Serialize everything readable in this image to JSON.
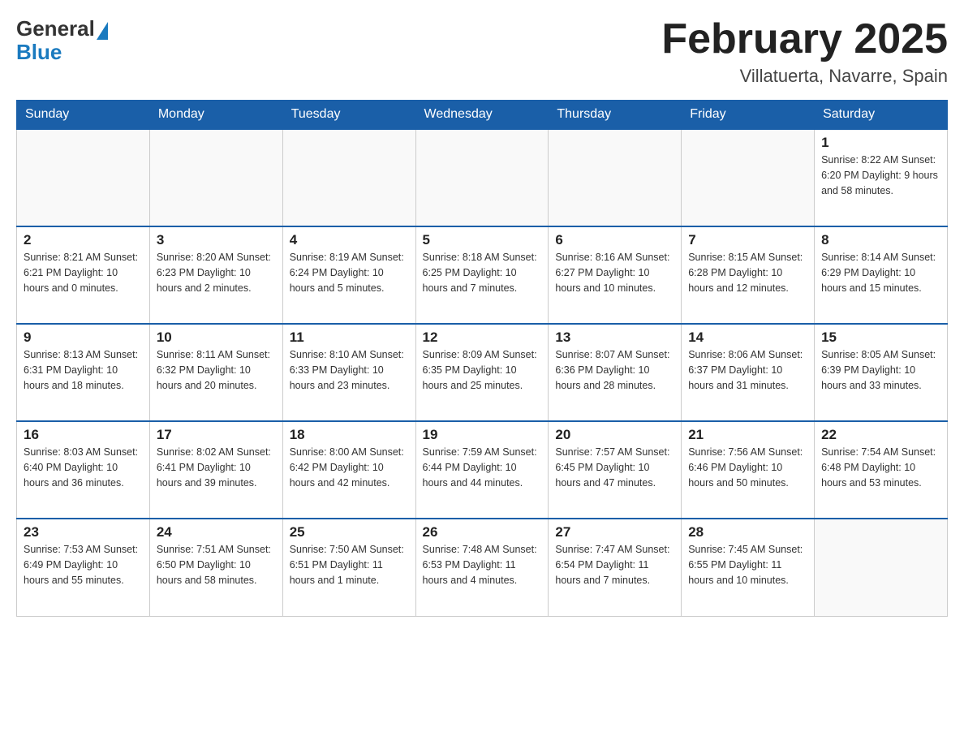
{
  "header": {
    "logo": {
      "general": "General",
      "blue": "Blue"
    },
    "title": "February 2025",
    "location": "Villatuerta, Navarre, Spain"
  },
  "weekdays": [
    "Sunday",
    "Monday",
    "Tuesday",
    "Wednesday",
    "Thursday",
    "Friday",
    "Saturday"
  ],
  "weeks": [
    [
      {
        "day": "",
        "info": ""
      },
      {
        "day": "",
        "info": ""
      },
      {
        "day": "",
        "info": ""
      },
      {
        "day": "",
        "info": ""
      },
      {
        "day": "",
        "info": ""
      },
      {
        "day": "",
        "info": ""
      },
      {
        "day": "1",
        "info": "Sunrise: 8:22 AM\nSunset: 6:20 PM\nDaylight: 9 hours and 58 minutes."
      }
    ],
    [
      {
        "day": "2",
        "info": "Sunrise: 8:21 AM\nSunset: 6:21 PM\nDaylight: 10 hours and 0 minutes."
      },
      {
        "day": "3",
        "info": "Sunrise: 8:20 AM\nSunset: 6:23 PM\nDaylight: 10 hours and 2 minutes."
      },
      {
        "day": "4",
        "info": "Sunrise: 8:19 AM\nSunset: 6:24 PM\nDaylight: 10 hours and 5 minutes."
      },
      {
        "day": "5",
        "info": "Sunrise: 8:18 AM\nSunset: 6:25 PM\nDaylight: 10 hours and 7 minutes."
      },
      {
        "day": "6",
        "info": "Sunrise: 8:16 AM\nSunset: 6:27 PM\nDaylight: 10 hours and 10 minutes."
      },
      {
        "day": "7",
        "info": "Sunrise: 8:15 AM\nSunset: 6:28 PM\nDaylight: 10 hours and 12 minutes."
      },
      {
        "day": "8",
        "info": "Sunrise: 8:14 AM\nSunset: 6:29 PM\nDaylight: 10 hours and 15 minutes."
      }
    ],
    [
      {
        "day": "9",
        "info": "Sunrise: 8:13 AM\nSunset: 6:31 PM\nDaylight: 10 hours and 18 minutes."
      },
      {
        "day": "10",
        "info": "Sunrise: 8:11 AM\nSunset: 6:32 PM\nDaylight: 10 hours and 20 minutes."
      },
      {
        "day": "11",
        "info": "Sunrise: 8:10 AM\nSunset: 6:33 PM\nDaylight: 10 hours and 23 minutes."
      },
      {
        "day": "12",
        "info": "Sunrise: 8:09 AM\nSunset: 6:35 PM\nDaylight: 10 hours and 25 minutes."
      },
      {
        "day": "13",
        "info": "Sunrise: 8:07 AM\nSunset: 6:36 PM\nDaylight: 10 hours and 28 minutes."
      },
      {
        "day": "14",
        "info": "Sunrise: 8:06 AM\nSunset: 6:37 PM\nDaylight: 10 hours and 31 minutes."
      },
      {
        "day": "15",
        "info": "Sunrise: 8:05 AM\nSunset: 6:39 PM\nDaylight: 10 hours and 33 minutes."
      }
    ],
    [
      {
        "day": "16",
        "info": "Sunrise: 8:03 AM\nSunset: 6:40 PM\nDaylight: 10 hours and 36 minutes."
      },
      {
        "day": "17",
        "info": "Sunrise: 8:02 AM\nSunset: 6:41 PM\nDaylight: 10 hours and 39 minutes."
      },
      {
        "day": "18",
        "info": "Sunrise: 8:00 AM\nSunset: 6:42 PM\nDaylight: 10 hours and 42 minutes."
      },
      {
        "day": "19",
        "info": "Sunrise: 7:59 AM\nSunset: 6:44 PM\nDaylight: 10 hours and 44 minutes."
      },
      {
        "day": "20",
        "info": "Sunrise: 7:57 AM\nSunset: 6:45 PM\nDaylight: 10 hours and 47 minutes."
      },
      {
        "day": "21",
        "info": "Sunrise: 7:56 AM\nSunset: 6:46 PM\nDaylight: 10 hours and 50 minutes."
      },
      {
        "day": "22",
        "info": "Sunrise: 7:54 AM\nSunset: 6:48 PM\nDaylight: 10 hours and 53 minutes."
      }
    ],
    [
      {
        "day": "23",
        "info": "Sunrise: 7:53 AM\nSunset: 6:49 PM\nDaylight: 10 hours and 55 minutes."
      },
      {
        "day": "24",
        "info": "Sunrise: 7:51 AM\nSunset: 6:50 PM\nDaylight: 10 hours and 58 minutes."
      },
      {
        "day": "25",
        "info": "Sunrise: 7:50 AM\nSunset: 6:51 PM\nDaylight: 11 hours and 1 minute."
      },
      {
        "day": "26",
        "info": "Sunrise: 7:48 AM\nSunset: 6:53 PM\nDaylight: 11 hours and 4 minutes."
      },
      {
        "day": "27",
        "info": "Sunrise: 7:47 AM\nSunset: 6:54 PM\nDaylight: 11 hours and 7 minutes."
      },
      {
        "day": "28",
        "info": "Sunrise: 7:45 AM\nSunset: 6:55 PM\nDaylight: 11 hours and 10 minutes."
      },
      {
        "day": "",
        "info": ""
      }
    ]
  ]
}
